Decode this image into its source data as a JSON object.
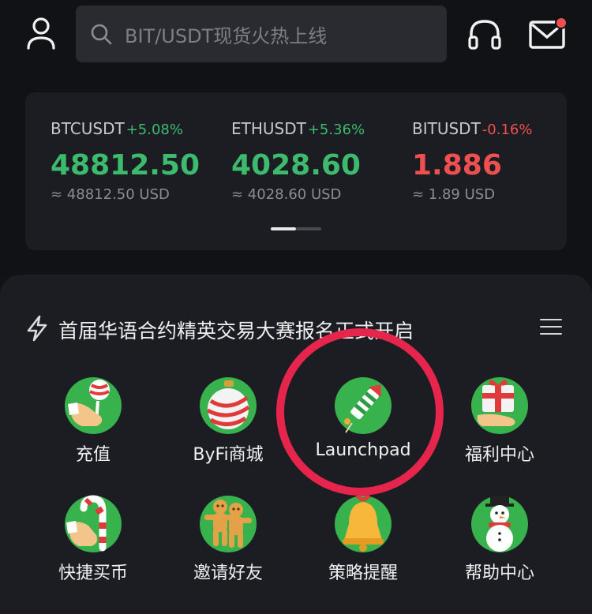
{
  "header": {
    "search_placeholder": "BIT/USDT现货火热上线",
    "icons": [
      "user-icon",
      "search-icon",
      "headset-icon",
      "mail-icon"
    ]
  },
  "market": {
    "tickers": [
      {
        "symbol": "BTCUSDT",
        "change": "+5.08%",
        "price": "48812.50",
        "usd": "≈ 48812.50 USD",
        "trend": "up"
      },
      {
        "symbol": "ETHUSDT",
        "change": "+5.36%",
        "price": "4028.60",
        "usd": "≈ 4028.60 USD",
        "trend": "up"
      },
      {
        "symbol": "BITUSDT",
        "change": "-0.16%",
        "price": "1.886",
        "usd": "≈ 1.89 USD",
        "trend": "down"
      }
    ],
    "pager": {
      "pages": 2,
      "active": 1
    }
  },
  "announcement": {
    "text": "首届华语合约精英交易大赛报名正式开启"
  },
  "grid": [
    {
      "label": "充值",
      "icon": "hand-lollipop-icon"
    },
    {
      "label": "ByFi商城",
      "icon": "ornament-icon"
    },
    {
      "label": "Launchpad",
      "icon": "firework-icon"
    },
    {
      "label": "福利中心",
      "icon": "gift-hand-icon"
    },
    {
      "label": "快捷买币",
      "icon": "candy-cane-icon"
    },
    {
      "label": "邀请好友",
      "icon": "gingerbread-icon"
    },
    {
      "label": "策略提醒",
      "icon": "bell-icon"
    },
    {
      "label": "帮助中心",
      "icon": "snowman-icon"
    }
  ],
  "colors": {
    "up": "#3cba6d",
    "down": "#ef4f50",
    "accent_green": "#37b24d",
    "highlight": "#e6254d"
  }
}
